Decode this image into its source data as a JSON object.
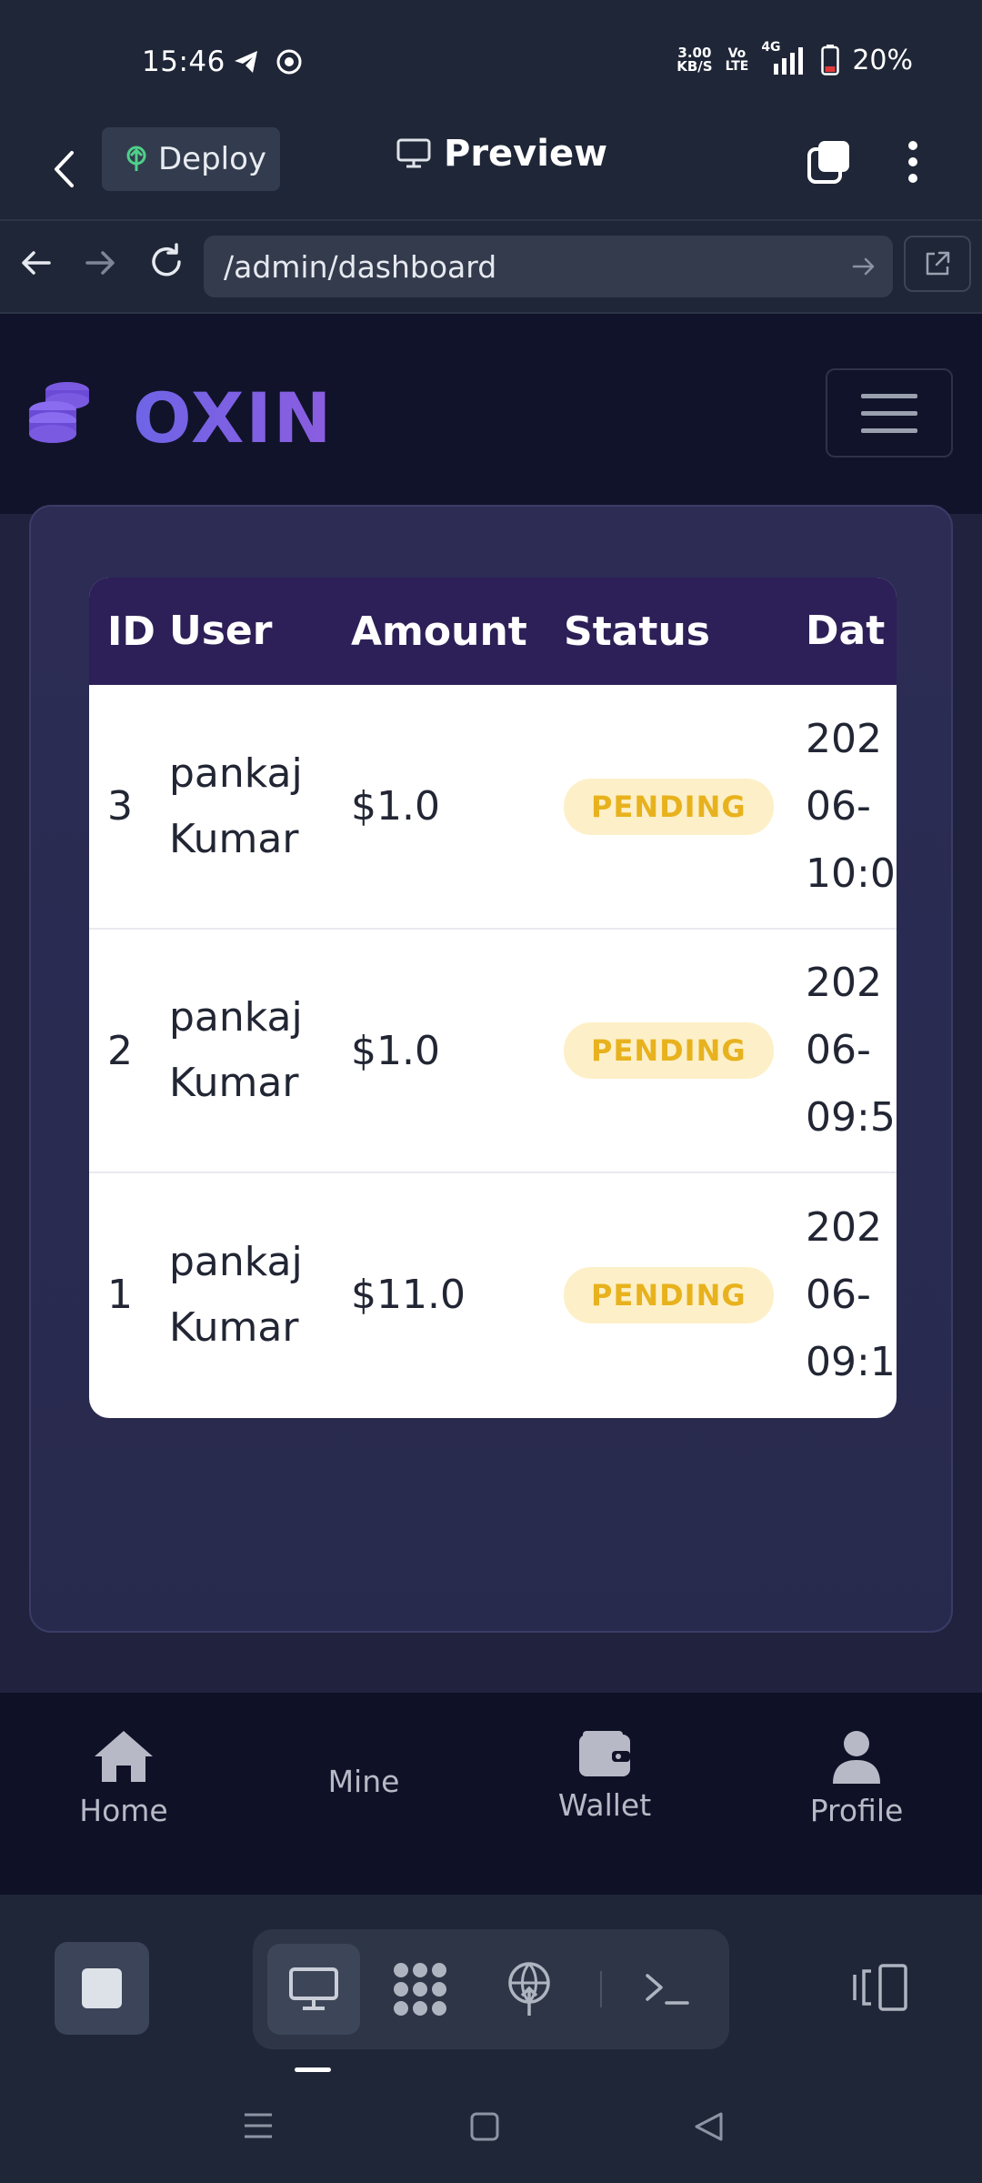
{
  "status_bar": {
    "time": "15:46",
    "net_speed_value": "3.00",
    "net_speed_unit": "KB/S",
    "volte_top": "Vo",
    "volte_bottom": "LTE",
    "network": "4G",
    "battery": "20%"
  },
  "preview_bar": {
    "deploy_label": "Deploy",
    "title": "Preview"
  },
  "url_bar": {
    "url": "/admin/dashboard"
  },
  "site": {
    "logo_text": "OXIN"
  },
  "table": {
    "headers": [
      "ID",
      "User",
      "Amount",
      "Status",
      "Dat"
    ],
    "rows": [
      {
        "id": "3",
        "user_first": "pankaj",
        "user_last": "Kumar",
        "amount": "$1.0",
        "status": "PENDING",
        "date_1": "202",
        "date_2": "06-",
        "date_3": "10:0"
      },
      {
        "id": "2",
        "user_first": "pankaj",
        "user_last": "Kumar",
        "amount": "$1.0",
        "status": "PENDING",
        "date_1": "202",
        "date_2": "06-",
        "date_3": "09:5"
      },
      {
        "id": "1",
        "user_first": "pankaj",
        "user_last": "Kumar",
        "amount": "$11.0",
        "status": "PENDING",
        "date_1": "202",
        "date_2": "06-",
        "date_3": "09:1"
      }
    ]
  },
  "app_nav": {
    "home": "Home",
    "mine": "Mine",
    "wallet": "Wallet",
    "profile": "Profile"
  },
  "colors": {
    "header_bg": "#2d1f57",
    "badge_bg": "#fdf0c8",
    "badge_text": "#e8b21e",
    "logo": "#7a62e4"
  }
}
